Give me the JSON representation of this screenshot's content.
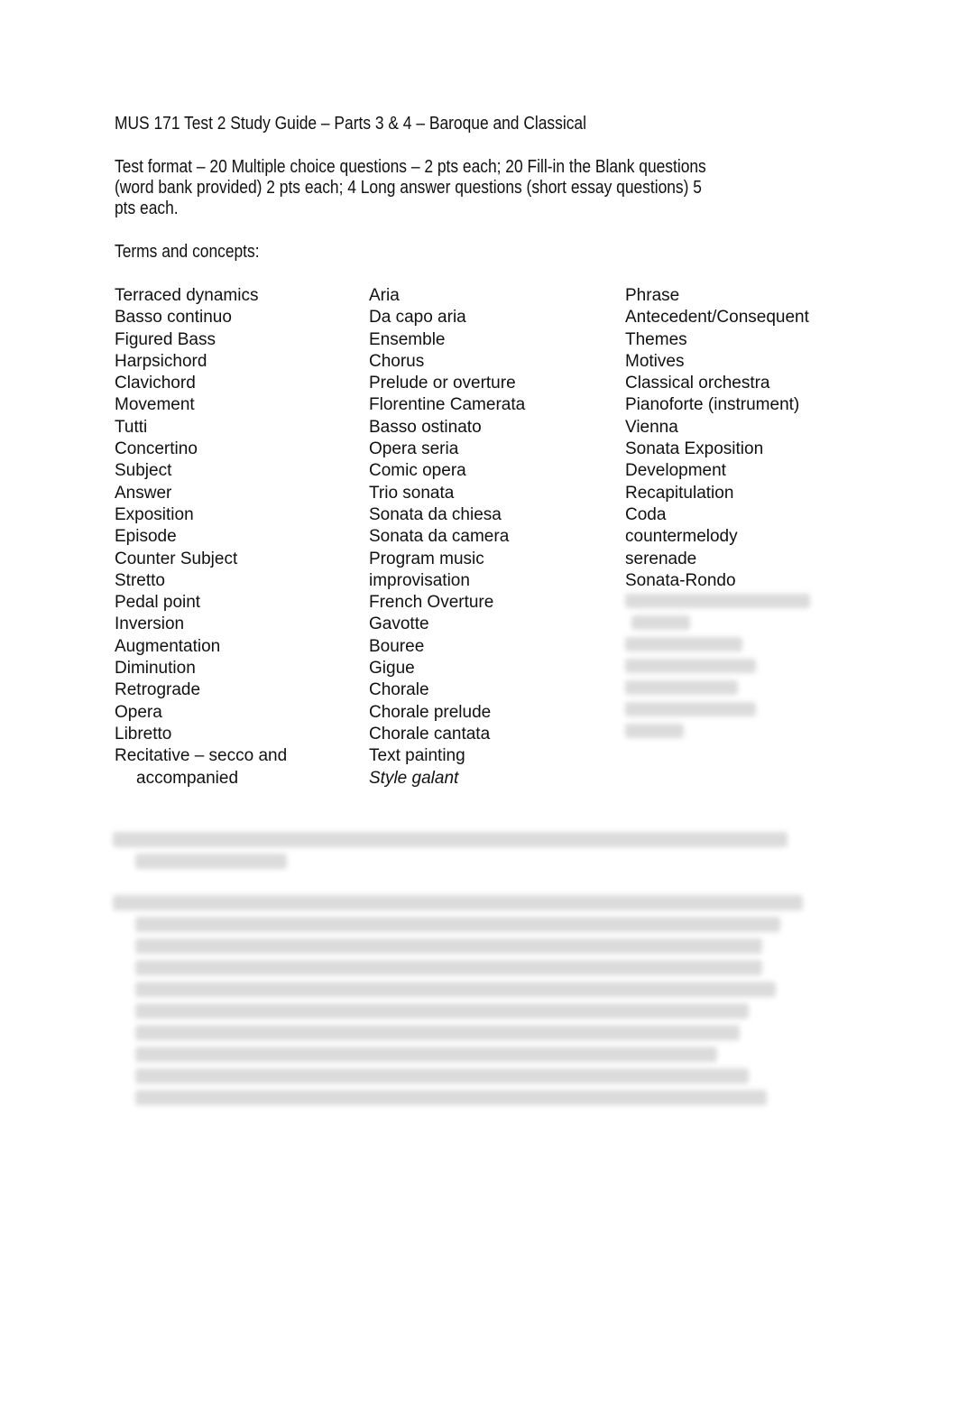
{
  "document": {
    "title": "MUS 171 Test 2 Study Guide – Parts 3 & 4 – Baroque and Classical",
    "test_format": [
      "Test format – 20 Multiple choice questions – 2 pts each; 20 Fill-in the Blank questions",
      "(word bank provided) 2 pts each; 4 Long answer questions (short essay questions) 5",
      "pts each."
    ],
    "terms_heading": "Terms and concepts:",
    "columns": [
      [
        "Terraced dynamics",
        "Basso continuo",
        "Figured Bass",
        "Harpsichord",
        "Clavichord",
        "Movement",
        "Tutti",
        "Concertino",
        "Subject",
        "Answer",
        "Exposition",
        "Episode",
        "Counter Subject",
        "Stretto",
        "Pedal point",
        "Inversion",
        "Augmentation",
        "Diminution",
        "Retrograde",
        "Opera",
        "Libretto",
        "Recitative – secco and",
        "accompanied"
      ],
      [
        "Aria",
        "Da capo aria",
        "Ensemble",
        "Chorus",
        "Prelude or overture",
        "Florentine Camerata",
        "Basso ostinato",
        "Opera seria",
        "Comic opera",
        "Trio sonata",
        "Sonata da chiesa",
        "Sonata da camera",
        "Program music",
        "improvisation",
        "French Overture",
        "Gavotte",
        "Bouree",
        "Gigue",
        "Chorale",
        "Chorale prelude",
        "Chorale cantata",
        "Text painting",
        "Style galant"
      ],
      [
        "Phrase",
        "Antecedent/Consequent",
        "Themes",
        "Motives",
        "Classical orchestra",
        "Pianoforte (instrument)",
        "Vienna",
        "Sonata Exposition",
        "Development",
        "Recapitulation",
        "Coda",
        "countermelody",
        "serenade",
        "Sonata-Rondo"
      ]
    ],
    "blurred_note": "Remaining content is blurred/obscured in the screenshot"
  }
}
